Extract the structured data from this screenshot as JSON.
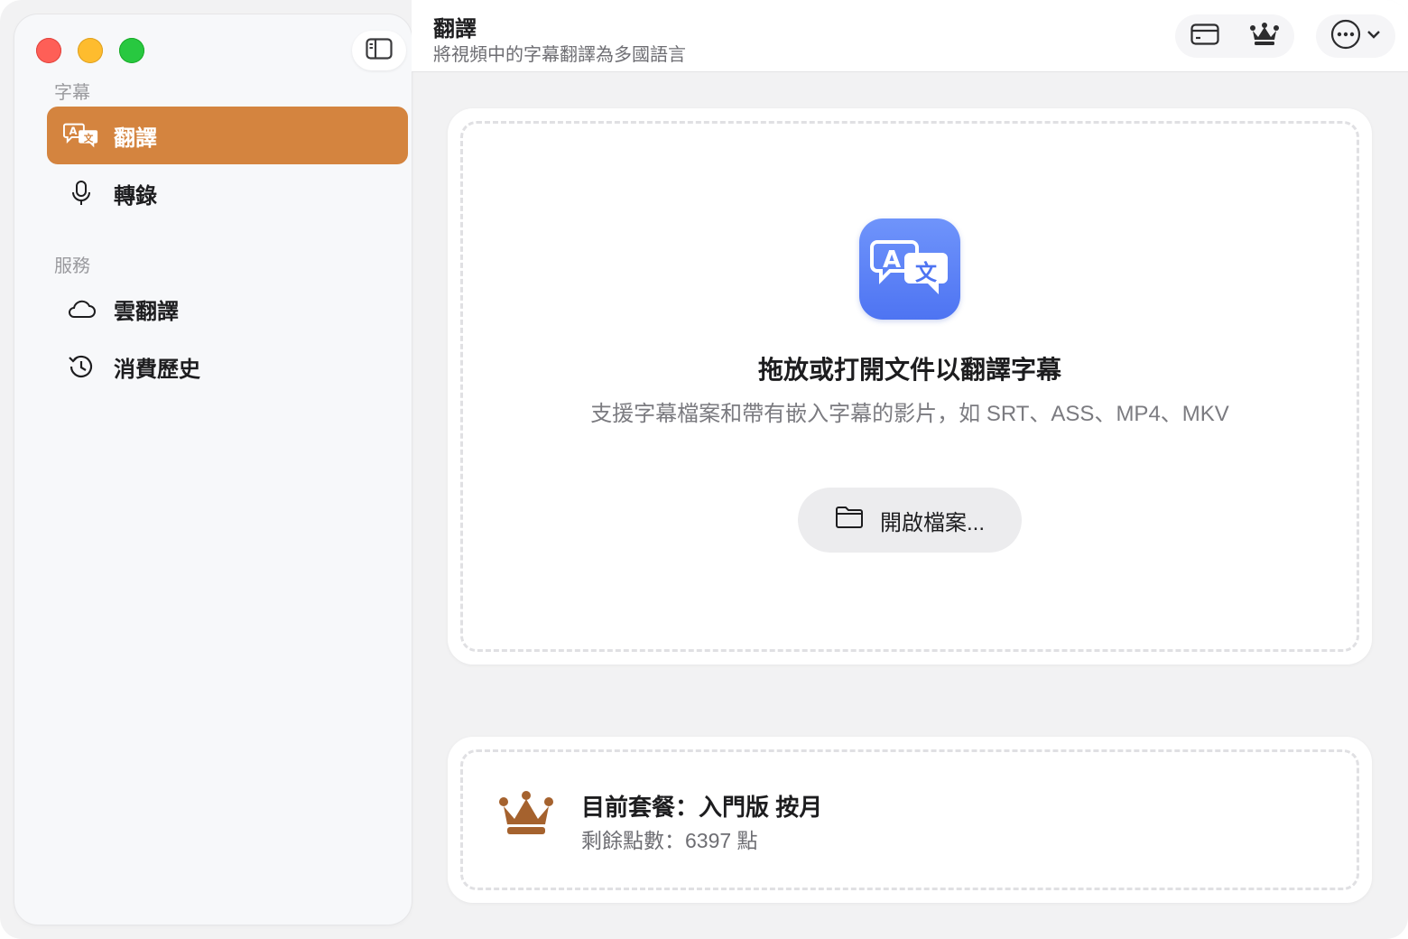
{
  "sidebar": {
    "sections": [
      {
        "label": "字幕",
        "items": [
          {
            "label": "翻譯",
            "icon": "translate-icon",
            "active": true
          },
          {
            "label": "轉錄",
            "icon": "microphone-icon",
            "active": false
          }
        ]
      },
      {
        "label": "服務",
        "items": [
          {
            "label": "雲翻譯",
            "icon": "cloud-icon",
            "active": false
          },
          {
            "label": "消費歷史",
            "icon": "history-icon",
            "active": false
          }
        ]
      }
    ]
  },
  "header": {
    "title": "翻譯",
    "subtitle": "將視頻中的字幕翻譯為多國語言"
  },
  "dropzone": {
    "title": "拖放或打開文件以翻譯字幕",
    "subtitle": "支援字幕檔案和帶有嵌入字幕的影片，如 SRT、ASS、MP4、MKV",
    "open_button": "開啟檔案..."
  },
  "plan": {
    "title": "目前套餐：入門版 按月",
    "points": "剩餘點數：6397 點"
  },
  "colors": {
    "accent": "#d4843f",
    "app_icon": "#5b7ff5",
    "crown": "#a5622e"
  }
}
